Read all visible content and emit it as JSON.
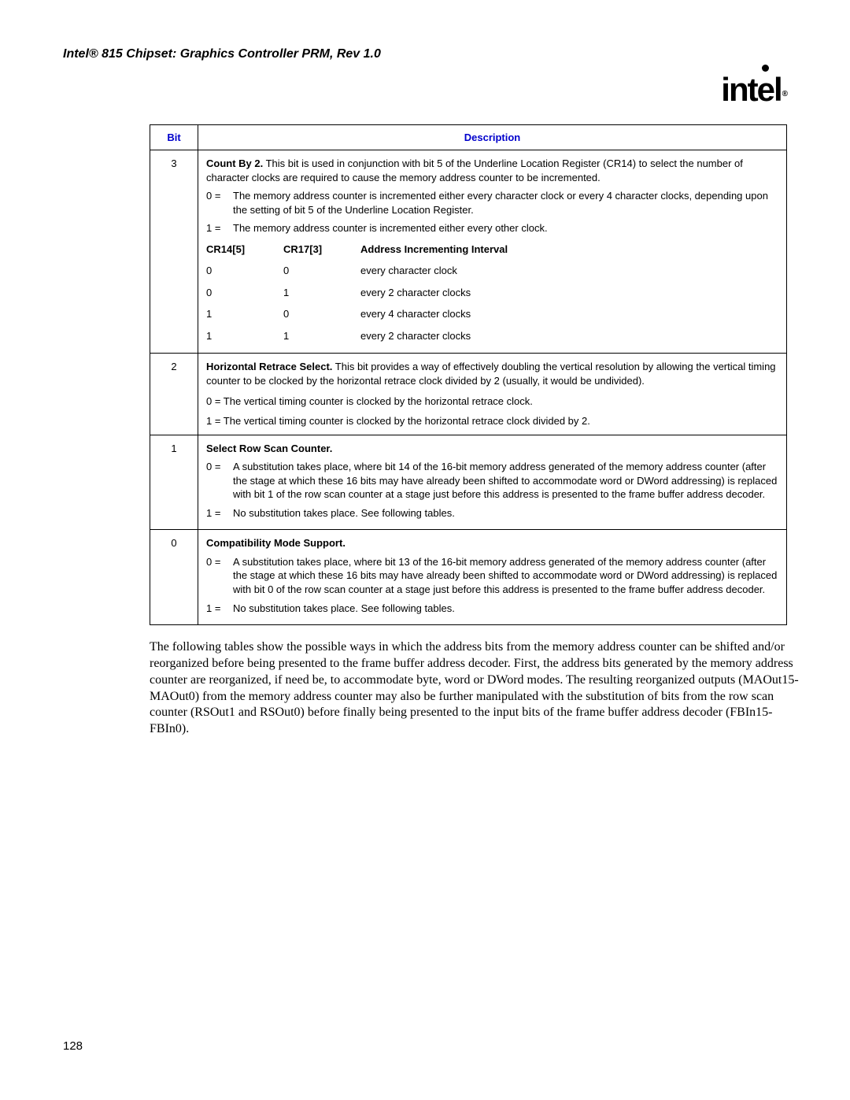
{
  "header": {
    "doc_title": "Intel® 815 Chipset: Graphics Controller PRM, Rev 1.0",
    "logo_main": "int",
    "logo_e": "e",
    "logo_l": "l",
    "logo_sub": "®"
  },
  "table": {
    "headers": {
      "bit": "Bit",
      "desc": "Description"
    },
    "rows": [
      {
        "bit": "3",
        "title_bold": "Count By 2.",
        "title_rest": " This bit is used in conjunction with bit 5 of the Underline Location Register (CR14) to select the number of character clocks are required to cause the memory address counter to be incremented.",
        "opt0": {
          "k": "0 =",
          "v": "The memory address counter is incremented either every character clock or every 4 character clocks, depending upon the setting of bit 5 of the Underline Location Register."
        },
        "opt1": {
          "k": "1 =",
          "v": "The memory address counter is incremented either every other clock."
        },
        "sub_header": {
          "a": "CR14[5]",
          "b": "CR17[3]",
          "c": "Address Incrementing Interval"
        },
        "sub_rows": [
          {
            "a": "0",
            "b": "0",
            "c": "every character clock"
          },
          {
            "a": "0",
            "b": "1",
            "c": "every 2 character clocks"
          },
          {
            "a": "1",
            "b": "0",
            "c": "every 4 character clocks"
          },
          {
            "a": "1",
            "b": "1",
            "c": "every 2 character clocks"
          }
        ]
      },
      {
        "bit": "2",
        "title_bold": "Horizontal Retrace Select.",
        "title_rest": " This bit provides a way of effectively doubling the vertical resolution by allowing the vertical timing counter to be clocked by the horizontal retrace clock divided by 2 (usually, it would be undivided).",
        "line0": "0 = The vertical timing counter is clocked by the horizontal retrace clock.",
        "line1": "1 = The vertical timing counter is clocked by the horizontal retrace clock divided by 2."
      },
      {
        "bit": "1",
        "title_bold": "Select Row Scan Counter.",
        "opt0": {
          "k": "0 =",
          "v": "A substitution takes place, where bit 14 of the 16-bit memory address generated of the memory address counter (after the stage at which these 16 bits may have already been shifted to accommodate word or DWord addressing) is replaced with bit 1 of the row scan counter at a stage just before this address is presented to the frame buffer address decoder."
        },
        "opt1": {
          "k": "1 =",
          "v": "No substitution takes place. See following tables."
        }
      },
      {
        "bit": "0",
        "title_bold": "Compatibility Mode Support.",
        "opt0": {
          "k": "0 =",
          "v": "A substitution takes place, where bit 13 of the 16-bit memory address generated of the memory address counter (after the stage at which these 16 bits may have already been shifted to accommodate word or DWord addressing) is replaced with bit 0 of the row scan counter at a stage just before this address is presented to the frame buffer address decoder."
        },
        "opt1": {
          "k": "1 =",
          "v": "No substitution takes place. See following tables."
        }
      }
    ]
  },
  "paragraph": "The following tables show the possible ways in which the address bits from the memory address counter can be shifted and/or reorganized before being presented to the frame buffer address decoder. First, the address bits generated by the memory address counter are reorganized, if need be, to accommodate byte, word or DWord modes. The resulting reorganized outputs (MAOut15-MAOut0) from the memory address counter may also be further manipulated with the substitution of bits from the row scan counter (RSOut1 and RSOut0) before finally being presented to the input bits of the frame buffer address decoder (FBIn15-FBIn0).",
  "page_number": "128"
}
